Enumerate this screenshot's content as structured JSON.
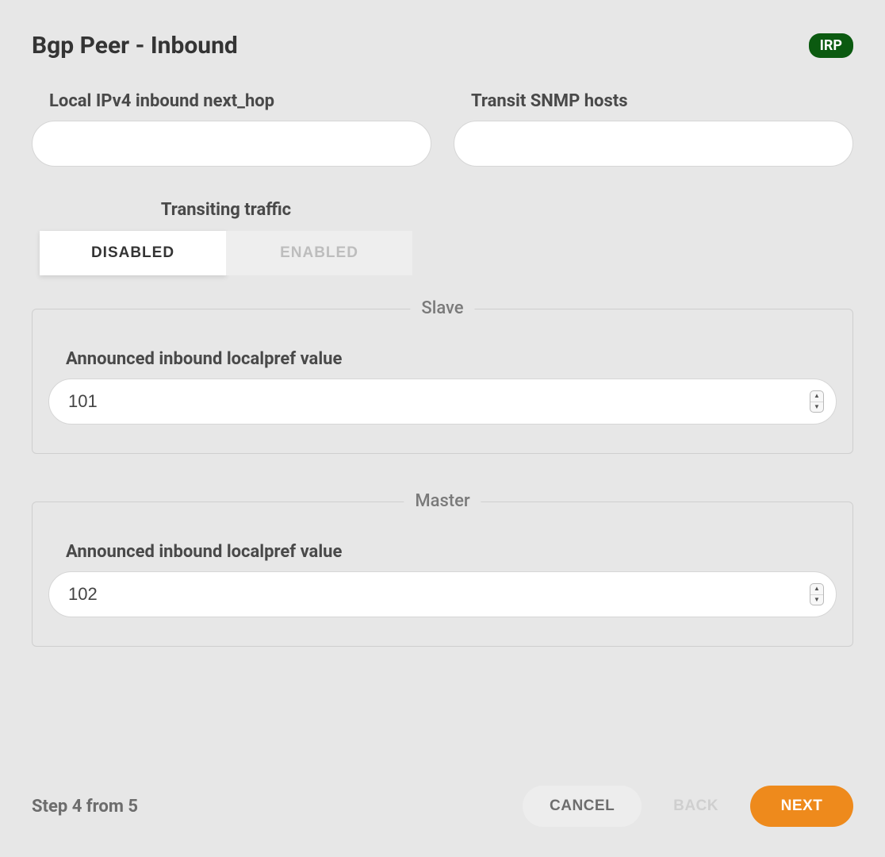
{
  "header": {
    "title": "Bgp Peer - Inbound",
    "badge": "IRP"
  },
  "fields": {
    "local_ipv4_label": "Local IPv4 inbound next_hop",
    "local_ipv4_value": "",
    "transit_snmp_label": "Transit SNMP hosts",
    "transit_snmp_value": ""
  },
  "toggle": {
    "label": "Transiting traffic",
    "disabled_label": "DISABLED",
    "enabled_label": "ENABLED",
    "active": "disabled"
  },
  "slave": {
    "legend": "Slave",
    "localpref_label": "Announced inbound localpref value",
    "localpref_value": "101"
  },
  "master": {
    "legend": "Master",
    "localpref_label": "Announced inbound localpref value",
    "localpref_value": "102"
  },
  "footer": {
    "step_text": "Step 4 from 5",
    "cancel_label": "CANCEL",
    "back_label": "BACK",
    "next_label": "NEXT"
  }
}
